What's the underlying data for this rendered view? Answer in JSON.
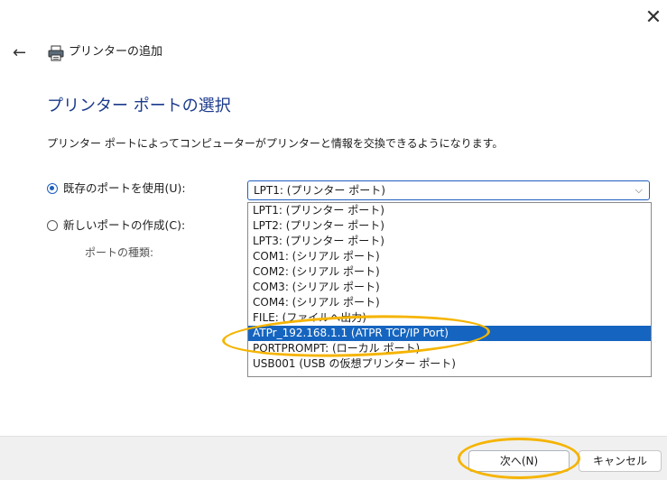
{
  "window": {
    "title": "プリンターの追加",
    "close_glyph": "✕",
    "back_glyph": "←"
  },
  "page": {
    "heading": "プリンター ポートの選択",
    "description": "プリンター ポートによってコンピューターがプリンターと情報を交換できるようになります。"
  },
  "options": {
    "use_existing": {
      "label": "既存のポートを使用(U):",
      "selected": true
    },
    "create_new": {
      "label": "新しいポートの作成(C):",
      "selected": false
    },
    "port_type_label": "ポートの種類:"
  },
  "port_select": {
    "value": "LPT1: (プリンター ポート)",
    "chevron": "⌵",
    "items": [
      "LPT1: (プリンター ポート)",
      "LPT2: (プリンター ポート)",
      "LPT3: (プリンター ポート)",
      "COM1: (シリアル ポート)",
      "COM2: (シリアル ポート)",
      "COM3: (シリアル ポート)",
      "COM4: (シリアル ポート)",
      "FILE: (ファイルへ出力)",
      "ATPr_192.168.1.1 (ATPR TCP/IP Port)",
      "PORTPROMPT: (ローカル ポート)",
      "USB001 (USB の仮想プリンター ポート)"
    ],
    "highlighted_index": 8
  },
  "buttons": {
    "next": "次へ(N)",
    "cancel": "キャンセル"
  },
  "colors": {
    "accent": "#1f5fbf",
    "heading": "#1b3a8c",
    "highlight": "#1565c0",
    "annotation_ring": "#f5b400",
    "footer_bg": "#f0f0f0"
  },
  "icons": {
    "close": "close-icon",
    "back": "back-arrow-icon",
    "printer": "printer-icon",
    "dropdown": "chevron-down-icon"
  }
}
